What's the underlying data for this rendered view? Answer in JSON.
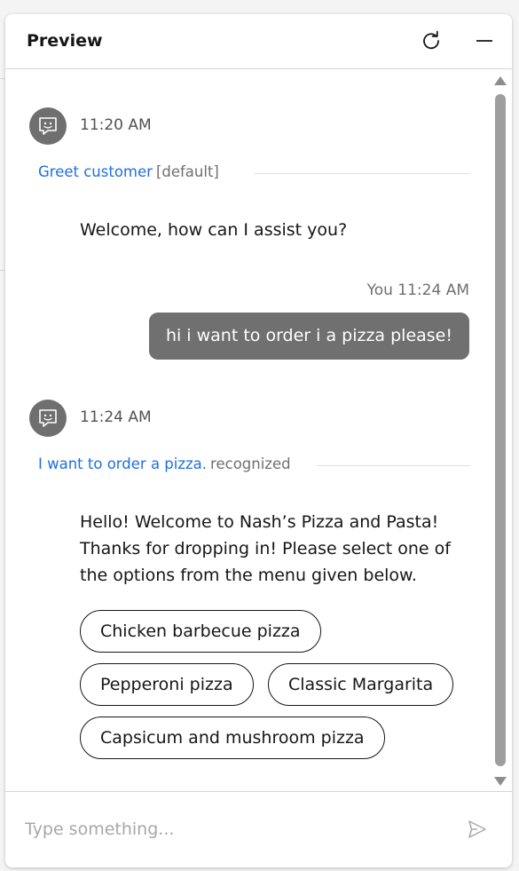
{
  "header": {
    "title": "Preview",
    "refresh_icon": "refresh-icon",
    "minimize_icon": "minimize-icon"
  },
  "messages": [
    {
      "sender": "bot",
      "time": "11:20 AM",
      "intent": {
        "name": "Greet customer",
        "status": "[default]"
      },
      "text": "Welcome, how can I assist you?"
    },
    {
      "sender": "user",
      "time": "You 11:24 AM",
      "text": "hi i want to order i a pizza please!"
    },
    {
      "sender": "bot",
      "time": "11:24 AM",
      "intent": {
        "name": "I want to order a pizza.",
        "status": "recognized"
      },
      "text": "Hello! Welcome to Nash’s Pizza and Pasta! Thanks for dropping in! Please select one of the options from the menu given below.",
      "options": [
        "Chicken barbecue pizza",
        "Pepperoni pizza",
        "Classic Margarita",
        "Capsicum and mushroom pizza"
      ]
    }
  ],
  "composer": {
    "placeholder": "Type something...",
    "send_icon": "send-icon"
  },
  "colors": {
    "link": "#1f6fe0",
    "avatar": "#6f6f6f",
    "user_bubble": "#707070"
  }
}
